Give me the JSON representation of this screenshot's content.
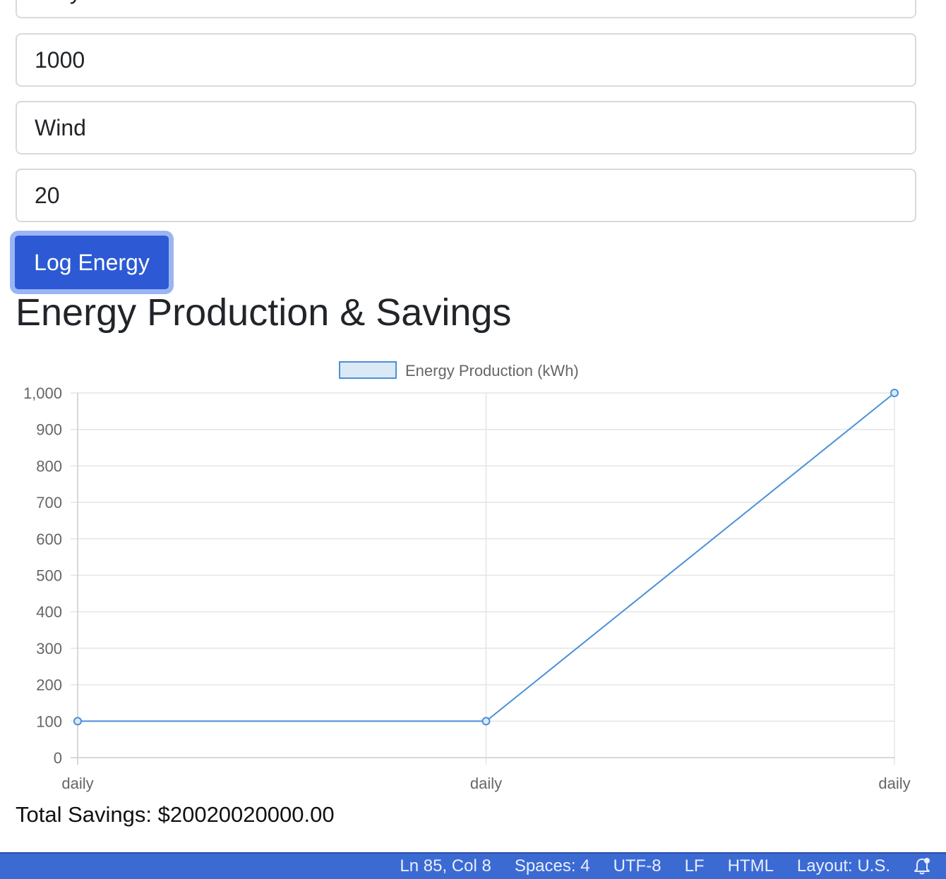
{
  "form": {
    "top_field_value": "daily",
    "amount_value": "1000",
    "type_value": "Wind",
    "rate_value": "20",
    "submit_label": "Log Energy"
  },
  "section_title": "Energy Production & Savings",
  "chart_data": {
    "type": "line",
    "categories": [
      "daily",
      "daily",
      "daily"
    ],
    "series": [
      {
        "name": "Energy Production (kWh)",
        "values": [
          100,
          100,
          1000
        ]
      }
    ],
    "ylim": [
      0,
      1000
    ],
    "y_ticks": [
      0,
      100,
      200,
      300,
      400,
      500,
      600,
      700,
      800,
      900,
      1000
    ],
    "y_tick_labels": [
      "0",
      "100",
      "200",
      "300",
      "400",
      "500",
      "600",
      "700",
      "800",
      "900",
      "1,000"
    ],
    "grid": true,
    "legend_position": "top-center",
    "colors": {
      "line": "#4a90d9",
      "fill": "#dbe9f7",
      "grid": "#e5e5e5",
      "text": "#666666"
    }
  },
  "savings": {
    "label": "Total Savings: $20020020000.00"
  },
  "statusbar": {
    "cursor": "Ln 85, Col 8",
    "spaces": "Spaces: 4",
    "encoding": "UTF-8",
    "eol": "LF",
    "language": "HTML",
    "layout": "Layout: U.S.",
    "notification_icon": "bell-icon",
    "background": "#3b6ad3"
  }
}
